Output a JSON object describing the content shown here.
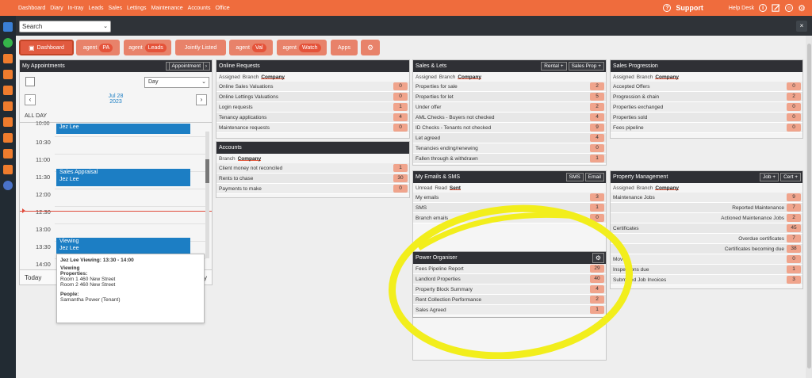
{
  "topnav": [
    "Dashboard",
    "Diary",
    "In-tray",
    "Leads",
    "Sales",
    "Lettings",
    "Maintenance",
    "Accounts",
    "Office"
  ],
  "support": {
    "label": "Support",
    "help": "Help Desk"
  },
  "search": {
    "value": "Search"
  },
  "tabs": [
    {
      "label": "Dashboard"
    },
    {
      "prefix": "agent",
      "badge": "PA"
    },
    {
      "prefix": "agent",
      "badge": "Leads"
    },
    {
      "label": "Jointly Listed"
    },
    {
      "prefix": "agent",
      "badge": "Val"
    },
    {
      "prefix": "agent",
      "badge": "Watch"
    },
    {
      "label": "Apps"
    }
  ],
  "appointments": {
    "title": "My Appointments",
    "btn": "Appointment",
    "view": "Day",
    "date": "Jul 28",
    "year": "2023",
    "allday": "ALL DAY",
    "times": [
      "10:30",
      "11:00",
      "11:30",
      "12:00",
      "12:30",
      "13:00",
      "13:30",
      "14:00"
    ],
    "events": [
      {
        "title": "",
        "person": "Jez Lee"
      },
      {
        "title": "Sales Appraisal",
        "person": "Jez Lee"
      },
      {
        "title": "Viewing",
        "person": "Jez Lee"
      }
    ],
    "today": "Today",
    "dayfrag": "y",
    "cut_time": "10:00"
  },
  "popup": {
    "title": "Jez Lee Viewing: 13:30 - 14:00",
    "type": "Viewing",
    "props_label": "Properties:",
    "props": [
      "Room 1 460 New Street",
      "Room 2 460 New Street"
    ],
    "people_label": "People:",
    "people": [
      "Samantha Power (Tenant)"
    ]
  },
  "online": {
    "title": "Online Requests",
    "filters": [
      "Assigned",
      "Branch",
      "Company"
    ],
    "rows": [
      [
        "Online Sales Valuations",
        "0"
      ],
      [
        "Online Lettings Valuations",
        "0"
      ],
      [
        "Login requests",
        "1"
      ],
      [
        "Tenancy applications",
        "4"
      ],
      [
        "Maintenance requests",
        "0"
      ]
    ]
  },
  "accounts": {
    "title": "Accounts",
    "filters": [
      "Branch",
      "Company"
    ],
    "rows": [
      [
        "Client money not reconciled",
        "1"
      ],
      [
        "Rents to chase",
        "30"
      ],
      [
        "Payments to make",
        "0"
      ]
    ]
  },
  "saleslets": {
    "title": "Sales & Lets",
    "btns": [
      "Rental +",
      "Sales Prop +"
    ],
    "filters": [
      "Assigned",
      "Branch",
      "Company"
    ],
    "rows": [
      [
        "Properties for sale",
        "2"
      ],
      [
        "Properties for let",
        "5"
      ],
      [
        "Under offer",
        "2"
      ],
      [
        "AML Checks - Buyers not checked",
        "4"
      ],
      [
        "ID Checks - Tenants not checked",
        "9"
      ],
      [
        "Let agreed",
        "4"
      ],
      [
        "Tenancies ending/renewing",
        "0"
      ],
      [
        "Fallen through & withdrawn",
        "1"
      ]
    ]
  },
  "emails": {
    "title": "My Emails & SMS",
    "btns": [
      "SMS",
      "Email"
    ],
    "filters": [
      "Unread",
      "Read",
      "Sent"
    ],
    "rows": [
      [
        "My emails",
        "3"
      ],
      [
        "SMS",
        "1"
      ],
      [
        "Branch emails",
        "0"
      ]
    ]
  },
  "power": {
    "title": "Power Organiser",
    "rows": [
      [
        "Fees Pipeline Report",
        "29"
      ],
      [
        "Landlord Properties",
        "40"
      ],
      [
        "Property Block Summary",
        "4"
      ],
      [
        "Rent Collection Performance",
        "2"
      ],
      [
        "Sales Agreed",
        "1"
      ]
    ]
  },
  "salesprog": {
    "title": "Sales Progression",
    "filters": [
      "Assigned",
      "Branch",
      "Company"
    ],
    "rows": [
      [
        "Accepted Offers",
        "0"
      ],
      [
        "Progression & chain",
        "2"
      ],
      [
        "Properties exchanged",
        "0"
      ],
      [
        "Properties sold",
        "0"
      ],
      [
        "Fees pipeline",
        "0"
      ]
    ]
  },
  "propmgmt": {
    "title": "Property Management",
    "btns": [
      "Job +",
      "Cert +"
    ],
    "filters": [
      "Assigned",
      "Branch",
      "Company"
    ],
    "rows": [
      [
        "Maintenance Jobs",
        "9",
        false
      ],
      [
        "Reported Maintenance",
        "7",
        true
      ],
      [
        "Actioned Maintenance Jobs",
        "2",
        true
      ],
      [
        "Certificates",
        "45",
        false
      ],
      [
        "Overdue certificates",
        "7",
        true
      ],
      [
        "Certificates becoming due",
        "38",
        true
      ],
      [
        "Moves",
        "0",
        false
      ],
      [
        "Inspections due",
        "1",
        false
      ],
      [
        "Submitted Job Invoices",
        "3",
        false
      ]
    ]
  }
}
